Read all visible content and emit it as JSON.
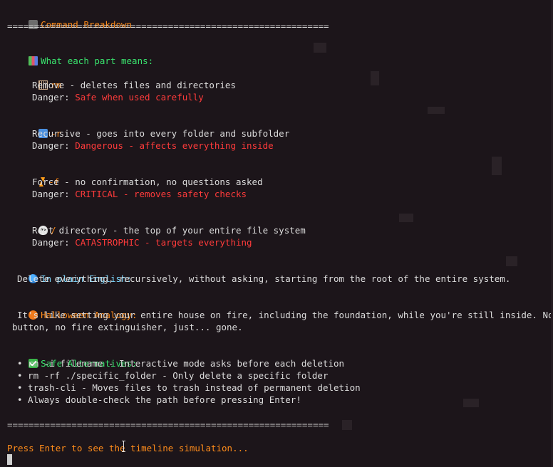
{
  "header": {
    "icon": "graduation-cap-icon",
    "title": "Command Breakdown",
    "separator": "============================================================"
  },
  "section_parts": {
    "icon": "books-icon",
    "heading": "What each part means:",
    "parts": [
      {
        "icon": "wastebasket-icon",
        "flag": "rm",
        "description": "Remove - deletes files and directories",
        "danger_label": "Danger: ",
        "danger_value": "Safe when used carefully"
      },
      {
        "icon": "repeat-icon",
        "flag": "-r",
        "description": "Recursive - goes into every folder and subfolder",
        "danger_label": "Danger: ",
        "danger_value": "Dangerous - affects everything inside"
      },
      {
        "icon": "lightning-icon",
        "flag": "-f",
        "description": "Force - no confirmation, no questions asked",
        "danger_label": "Danger: ",
        "danger_value": "CRITICAL - removes safety checks"
      },
      {
        "icon": "skull-icon",
        "flag": "/",
        "description": "Root directory - the top of your entire file system",
        "danger_label": "Danger: ",
        "danger_value": "CATASTROPHIC - targets everything"
      }
    ]
  },
  "plain_english": {
    "icon": "globe-icon",
    "heading": "In plain English:",
    "text": "Delete everything, recursively, without asking, starting from the root of the entire system."
  },
  "halloween": {
    "icon": "pumpkin-icon",
    "heading": "Halloween Analogy:",
    "line1": "It's like setting your entire house on fire, including the foundation, while you're still inside. No 'undo'",
    "line2": "button, no fire extinguisher, just... gone."
  },
  "alternatives": {
    "icon": "check-mark-icon",
    "heading": "Safe Alternatives:",
    "items": [
      "• rm -i filename - Interactive mode asks before each deletion",
      "• rm -rf ./specific_folder - Only delete a specific folder",
      "• trash-cli - Moves files to trash instead of permanent deletion",
      "• Always double-check the path before pressing Enter!"
    ]
  },
  "footer": {
    "separator": "============================================================",
    "prompt": "Press Enter to see the timeline simulation..."
  },
  "colors": {
    "background": "#1c151a",
    "accent_orange": "#ff8c1a",
    "accent_green": "#39e26d",
    "accent_cyan": "#7dd8ff",
    "danger_red": "#ff3b3b"
  }
}
